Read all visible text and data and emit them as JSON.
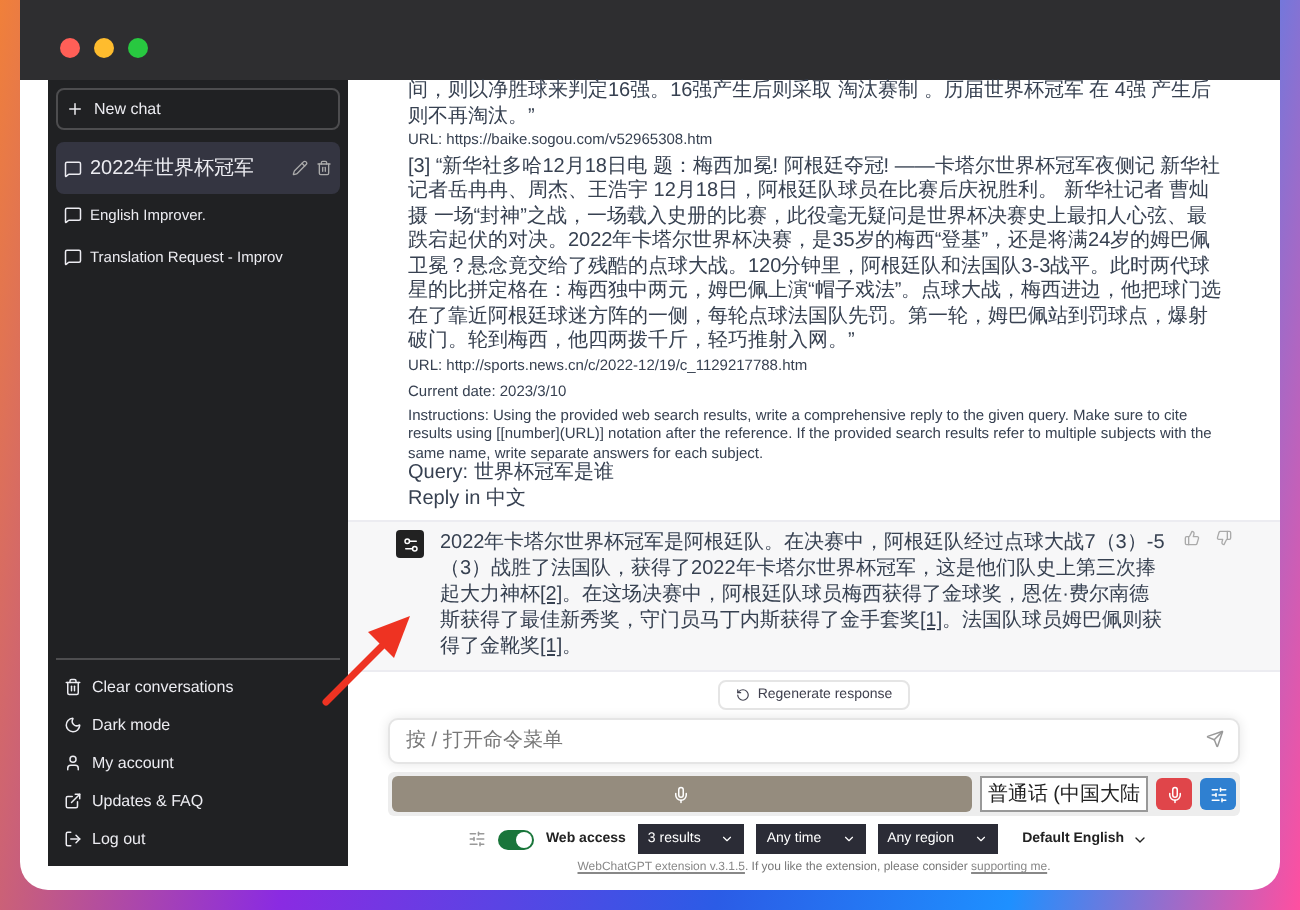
{
  "sidebar": {
    "new_chat": "New chat",
    "conversations": [
      {
        "title": "2022年世界杯冠军",
        "selected": true
      },
      {
        "title": "English Improver.",
        "selected": false
      },
      {
        "title": "Translation Request - Improv",
        "selected": false
      }
    ],
    "menu": [
      {
        "label": "Clear conversations",
        "kind": "trash"
      },
      {
        "label": "Dark mode",
        "kind": "moon"
      },
      {
        "label": "My account",
        "kind": "user"
      },
      {
        "label": "Updates & FAQ",
        "kind": "link"
      },
      {
        "label": "Log out",
        "kind": "logout"
      }
    ]
  },
  "prompt": {
    "blocks": [
      {
        "kind": "text",
        "text": "间，则以净胜球来判定16强。16强产生后则采取 淘汰赛制 。历届世界杯冠军 在 4强 产生后则不再淘汰。”"
      },
      {
        "kind": "url",
        "text": "URL: https://baike.sogou.com/v52965308.htm"
      },
      {
        "kind": "gap"
      },
      {
        "kind": "text",
        "text": "[3] “新华社多哈12月18日电 题：梅西加冕! 阿根廷夺冠! ——卡塔尔世界杯冠军夜侧记 新华社记者岳冉冉、周杰、王浩宇 12月18日，阿根廷队球员在比赛后庆祝胜利。 新华社记者 曹灿摄 一场“封神”之战，一场载入史册的比赛，此役毫无疑问是世界杯决赛史上最扣人心弦、最跌宕起伏的对决。2022年卡塔尔世界杯决赛，是35岁的梅西“登基”，还是将满24岁的姆巴佩卫冕？悬念竟交给了残酷的点球大战。120分钟里，阿根廷队和法国队3-3战平。此时两代球星的比拼定格在：梅西独中两元，姆巴佩上演“帽子戏法”。点球大战，梅西进边，他把球门选在了靠近阿根廷球迷方阵的一侧，每轮点球法国队先罚。第一轮，姆巴佩站到罚球点，爆射破门。轮到梅西，他四两拨千斤，轻巧推射入网。”"
      },
      {
        "kind": "url",
        "text": "URL: http://sports.news.cn/c/2022-12/19/c_1129217788.htm"
      },
      {
        "kind": "gap"
      },
      {
        "kind": "text",
        "text": "Current date: 2023/3/10"
      },
      {
        "kind": "gap"
      },
      {
        "kind": "text",
        "text": "Instructions: Using the provided web search results, write a comprehensive reply to the given query. Make sure to cite results using [[number](URL)] notation after the reference. If the provided search results refer to multiple subjects with the same name, write separate answers for each subject."
      },
      {
        "kind": "text",
        "text": "Query: 世界杯冠军是谁"
      },
      {
        "kind": "text",
        "text": "Reply in 中文"
      }
    ]
  },
  "answer": {
    "parts": [
      {
        "kind": "text",
        "text": "2022年卡塔尔世界杯冠军是阿根廷队。在决赛中，阿根廷队经过点球大战7（3）-5（3）战胜了法国队，获得了2022年卡塔尔世界杯冠军，这是他们队史上第三次捧起大力神杯"
      },
      {
        "kind": "cite",
        "text": "[2]"
      },
      {
        "kind": "text",
        "text": "。在这场决赛中，阿根廷队球员梅西获得了金球奖，恩佐·费尔南德斯获得了最佳新秀奖，守门员马丁内斯获得了金手套奖"
      },
      {
        "kind": "cite",
        "text": "[1]"
      },
      {
        "kind": "text",
        "text": "。法国队球员姆巴佩则获得了金靴奖"
      },
      {
        "kind": "cite",
        "text": "[1]"
      },
      {
        "kind": "text",
        "text": "。"
      }
    ]
  },
  "regenerate": "Regenerate response",
  "input": {
    "placeholder": "按 / 打开命令菜单"
  },
  "voice": {
    "language": "普通话 (中国大陆"
  },
  "toolbar": {
    "web_access": {
      "label": "Web access",
      "on": true
    },
    "results": "3 results",
    "time": "Any time",
    "region": "Any region",
    "language": "Default English"
  },
  "footer": [
    {
      "kind": "link",
      "text": "WebChatGPT extension v.3.1.5"
    },
    {
      "kind": "text",
      "text": ". If you like the extension, please consider "
    },
    {
      "kind": "link",
      "text": "supporting me"
    },
    {
      "kind": "text",
      "text": "."
    }
  ]
}
